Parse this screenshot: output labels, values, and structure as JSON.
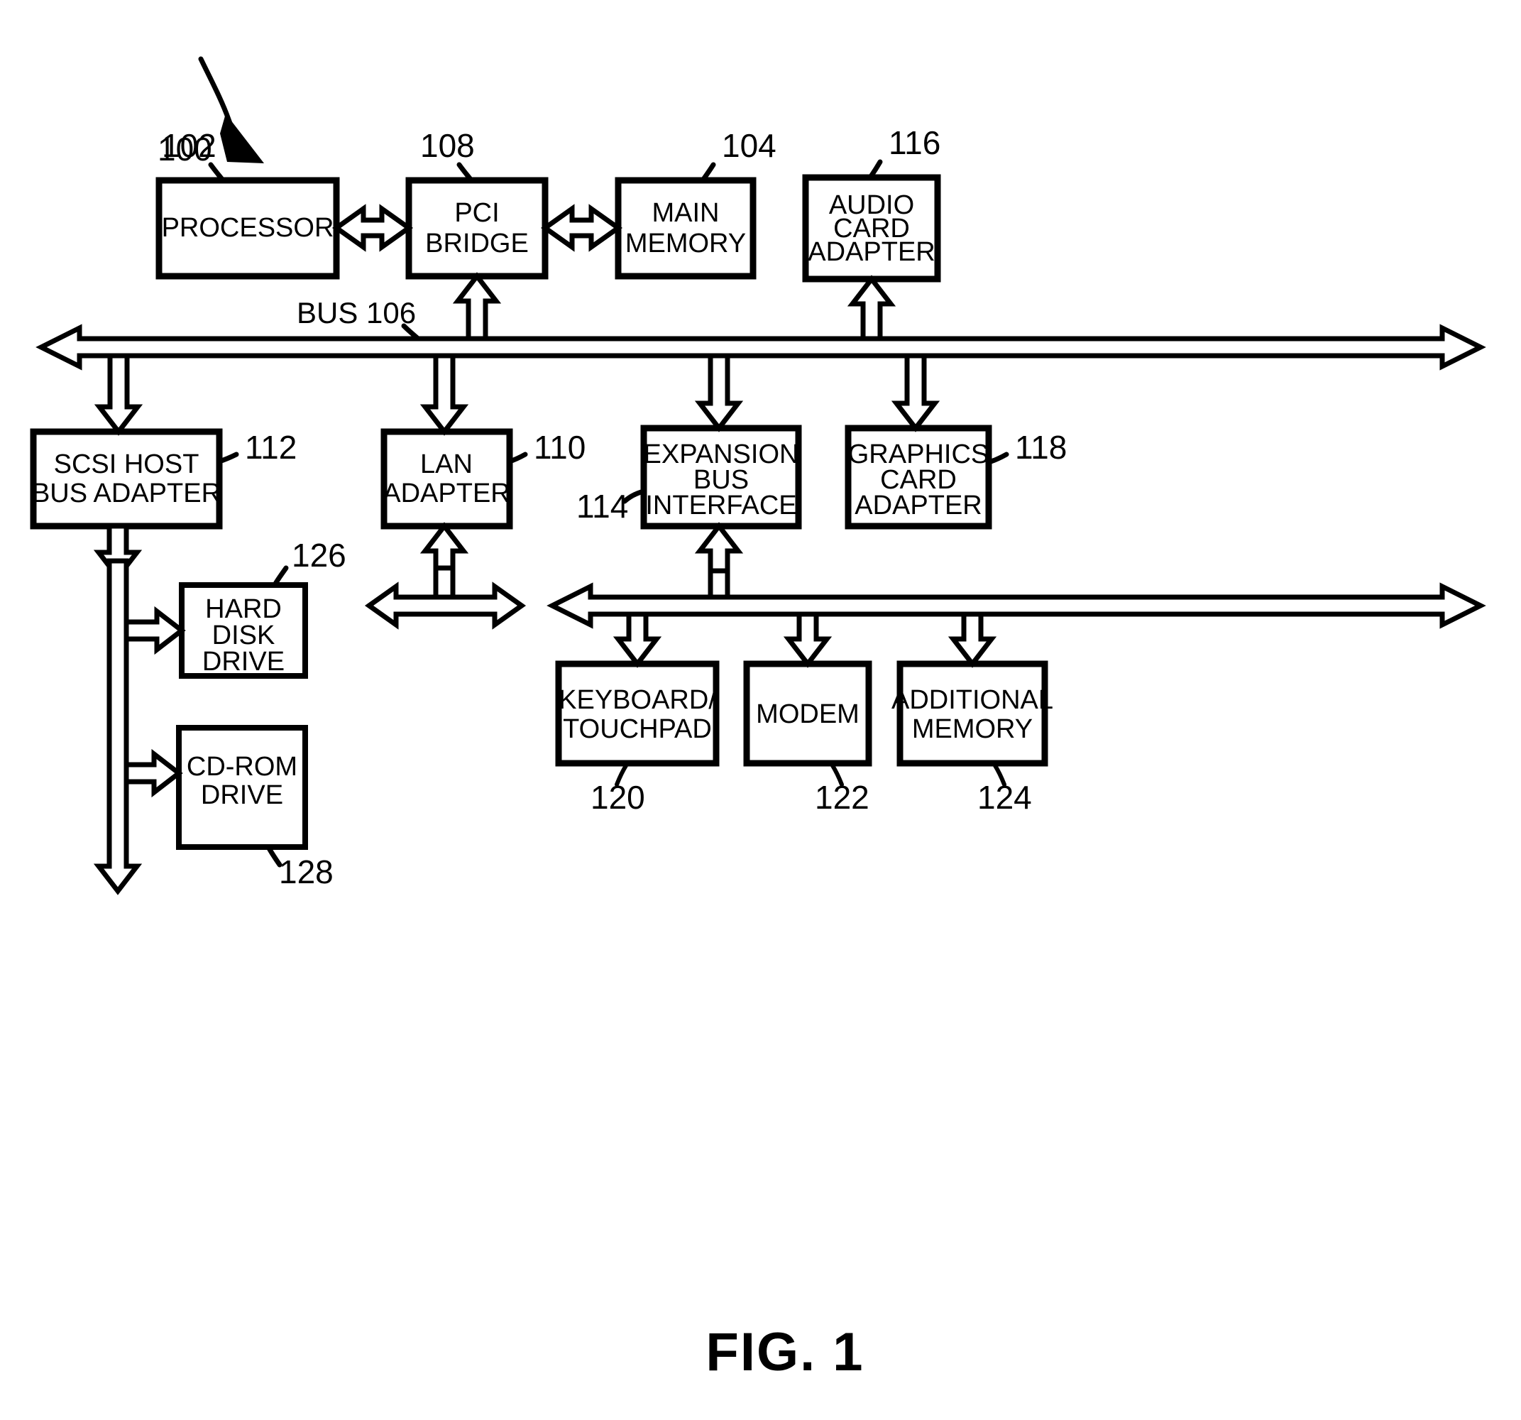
{
  "figure": {
    "caption": "FIG. 1",
    "system_ref": "100",
    "bus_label": "BUS 106"
  },
  "blocks": [
    {
      "id": "processor",
      "lines": [
        "PROCESSOR"
      ],
      "ref": "102"
    },
    {
      "id": "pci-bridge",
      "lines": [
        "PCI",
        "BRIDGE"
      ],
      "ref": "108"
    },
    {
      "id": "main-memory",
      "lines": [
        "MAIN",
        "MEMORY"
      ],
      "ref": "104"
    },
    {
      "id": "audio-card",
      "lines": [
        "AUDIO",
        "CARD",
        "ADAPTER"
      ],
      "ref": "116"
    },
    {
      "id": "scsi-host",
      "lines": [
        "SCSI HOST",
        "BUS ADAPTER"
      ],
      "ref": "112"
    },
    {
      "id": "lan-adapter",
      "lines": [
        "LAN",
        "ADAPTER"
      ],
      "ref": "110"
    },
    {
      "id": "expansion-bus",
      "lines": [
        "EXPANSION",
        "BUS",
        "INTERFACE"
      ],
      "ref": "114"
    },
    {
      "id": "graphics-card",
      "lines": [
        "GRAPHICS",
        "CARD",
        "ADAPTER"
      ],
      "ref": "118"
    },
    {
      "id": "hard-disk",
      "lines": [
        "HARD",
        "DISK",
        "DRIVE"
      ],
      "ref": "126"
    },
    {
      "id": "cd-rom",
      "lines": [
        "CD-ROM",
        "DRIVE"
      ],
      "ref": "128"
    },
    {
      "id": "keyboard",
      "lines": [
        "KEYBOARD/",
        "TOUCHPAD"
      ],
      "ref": "120"
    },
    {
      "id": "modem",
      "lines": [
        "MODEM"
      ],
      "ref": "122"
    },
    {
      "id": "additional-mem",
      "lines": [
        "ADDITIONAL",
        "MEMORY"
      ],
      "ref": "124"
    }
  ],
  "text": {
    "processor_l1": "PROCESSOR",
    "pci_l1": "PCI",
    "pci_l2": "BRIDGE",
    "mainmem_l1": "MAIN",
    "mainmem_l2": "MEMORY",
    "audio_l1": "AUDIO",
    "audio_l2": "CARD",
    "audio_l3": "ADAPTER",
    "scsi_l1": "SCSI HOST",
    "scsi_l2": "BUS ADAPTER",
    "lan_l1": "LAN",
    "lan_l2": "ADAPTER",
    "exp_l1": "EXPANSION",
    "exp_l2": "BUS",
    "exp_l3": "INTERFACE",
    "gfx_l1": "GRAPHICS",
    "gfx_l2": "CARD",
    "gfx_l3": "ADAPTER",
    "hdd_l1": "HARD",
    "hdd_l2": "DISK",
    "hdd_l3": "DRIVE",
    "cdrom_l1": "CD-ROM",
    "cdrom_l2": "DRIVE",
    "kbd_l1": "KEYBOARD/",
    "kbd_l2": "TOUCHPAD",
    "modem_l1": "MODEM",
    "addmem_l1": "ADDITIONAL",
    "addmem_l2": "MEMORY",
    "ref_100": "100",
    "ref_102": "102",
    "ref_104": "104",
    "ref_106": "BUS 106",
    "ref_108": "108",
    "ref_110": "110",
    "ref_112": "112",
    "ref_114": "114",
    "ref_116": "116",
    "ref_118": "118",
    "ref_120": "120",
    "ref_122": "122",
    "ref_124": "124",
    "ref_126": "126",
    "ref_128": "128",
    "caption": "FIG. 1"
  },
  "colors": {
    "ink": "#000000",
    "paper": "#ffffff"
  }
}
